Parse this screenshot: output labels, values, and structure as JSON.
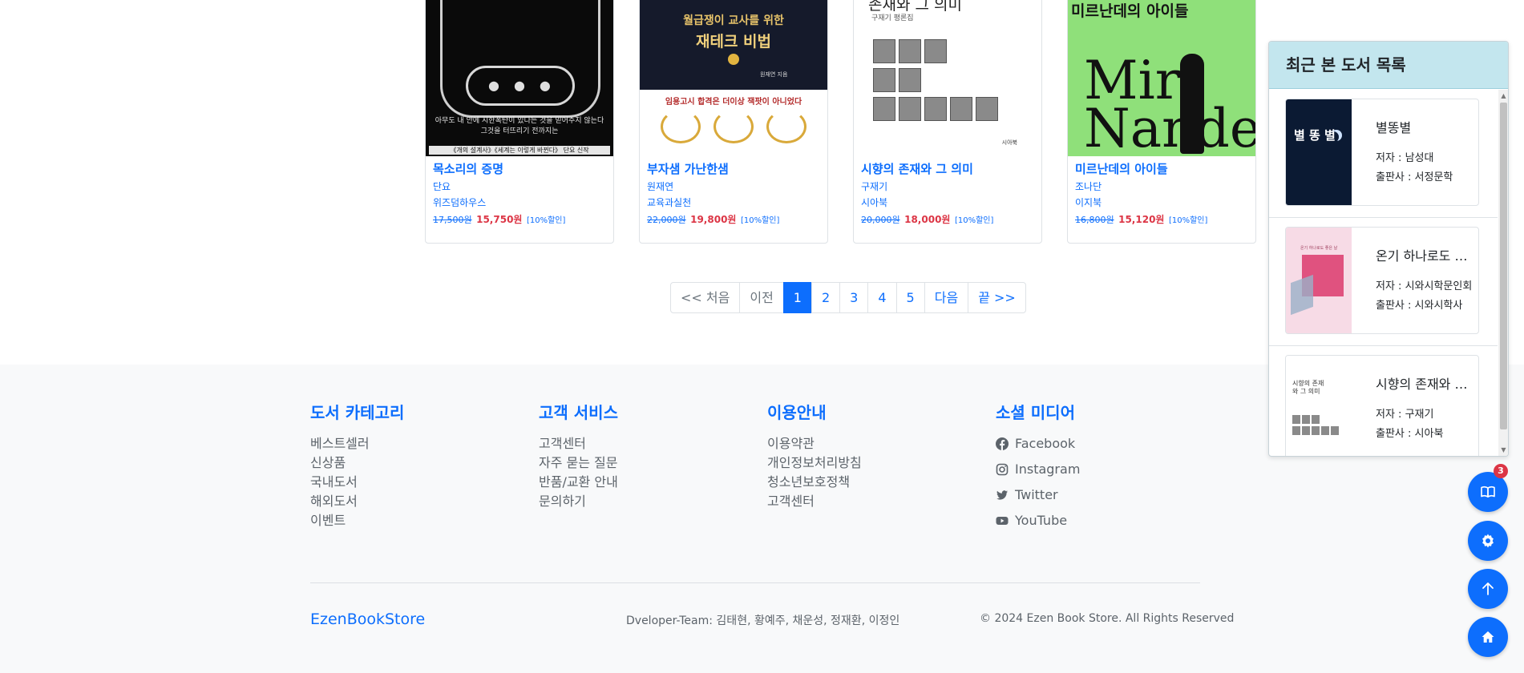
{
  "books": [
    {
      "title": "목소리의 증명",
      "author": "단요",
      "publisher": "위즈덤하우스",
      "original_price": "17,500원",
      "sale_price": "15,750원",
      "discount": "[10%할인]",
      "cover": {
        "caption_line1": "아무도 내 안에 시한폭탄이 있다는 것을 믿어주지 않는다",
        "caption_line2": "그것을 터뜨리기 전까지는",
        "bar_text": "《개의 설계사》《세계는 이렇게 바뀐다》 단요 신작"
      }
    },
    {
      "title": "부자샘 가난한샘",
      "author": "원재연",
      "publisher": "교육과실천",
      "original_price": "22,000원",
      "sale_price": "19,800원",
      "discount": "[10%할인]",
      "cover": {
        "line1": "월급쟁이 교사를 위한",
        "line2": "재테크 비법",
        "author_line": "원재연 지음",
        "tagline": "임용고시 합격은 더이상 잭팟이 아니었다"
      }
    },
    {
      "title": "시향의 존재와 그 의미",
      "author": "구재기",
      "publisher": "시아북",
      "original_price": "20,000원",
      "sale_price": "18,000원",
      "discount": "[10%할인]",
      "cover": {
        "title_text": "존재와 그 의미",
        "subtitle": "구재기 평론집",
        "pub": "시아북"
      }
    },
    {
      "title": "미르난데의 아이들",
      "author": "조나단",
      "publisher": "이지북",
      "original_price": "16,800원",
      "sale_price": "15,120원",
      "discount": "[10%할인]",
      "cover": {
        "title_text": "미르난데의  아이들",
        "big_text": "Mir Nande"
      }
    }
  ],
  "pagination": {
    "first": "<< 처음",
    "prev": "이전",
    "pages": [
      "1",
      "2",
      "3",
      "4",
      "5"
    ],
    "active_page": "1",
    "next": "다음",
    "last": "끝 >>"
  },
  "footer": {
    "columns": [
      {
        "heading": "도서 카테고리",
        "links": [
          "베스트셀러",
          "신상품",
          "국내도서",
          "해외도서",
          "이벤트"
        ]
      },
      {
        "heading": "고객 서비스",
        "links": [
          "고객센터",
          "자주 묻는 질문",
          "반품/교환 안내",
          "문의하기"
        ]
      },
      {
        "heading": "이용안내",
        "links": [
          "이용약관",
          "개인정보처리방침",
          "청소년보호정책",
          "고객센터"
        ]
      }
    ],
    "social": {
      "heading": "소셜 미디어",
      "links": [
        {
          "label": "Facebook",
          "icon": "facebook-icon"
        },
        {
          "label": "Instagram",
          "icon": "instagram-icon"
        },
        {
          "label": "Twitter",
          "icon": "twitter-icon"
        },
        {
          "label": "YouTube",
          "icon": "youtube-icon"
        }
      ]
    },
    "brand": "EzenBookStore",
    "team": "Dveloper-Team: 김태현, 황예주, 채운성, 정재환, 이정인",
    "copyright": "© 2024 Ezen Book Store. All Rights Reserved"
  },
  "recent_panel": {
    "title": "최근 본 도서 목록",
    "items": [
      {
        "title": "별똥별",
        "author": "저자 : 남성대",
        "publisher": "출판사 : 서정문학",
        "cover_text": "별 똥 별"
      },
      {
        "title": "온기 하나로도 좋은 날",
        "author": "저자 : 시와시학문인회",
        "publisher": "출판사 : 시와시학사",
        "cover_text": "온기 하나로도 좋은 날"
      },
      {
        "title": "시향의 존재와 그 의미",
        "author": "저자 : 구재기",
        "publisher": "출판사 : 시아북",
        "cover_text": "시향의 존재와 그 의미"
      }
    ]
  },
  "floating_buttons": {
    "recent_badge": "3",
    "icons": [
      "book-icon",
      "gear-icon",
      "arrow-up-icon",
      "home-icon"
    ]
  },
  "colors": {
    "primary": "#0d6efd",
    "sale": "#dc3545",
    "panel_header": "#c3e6ee",
    "footer_bg": "#f8f9fa"
  }
}
